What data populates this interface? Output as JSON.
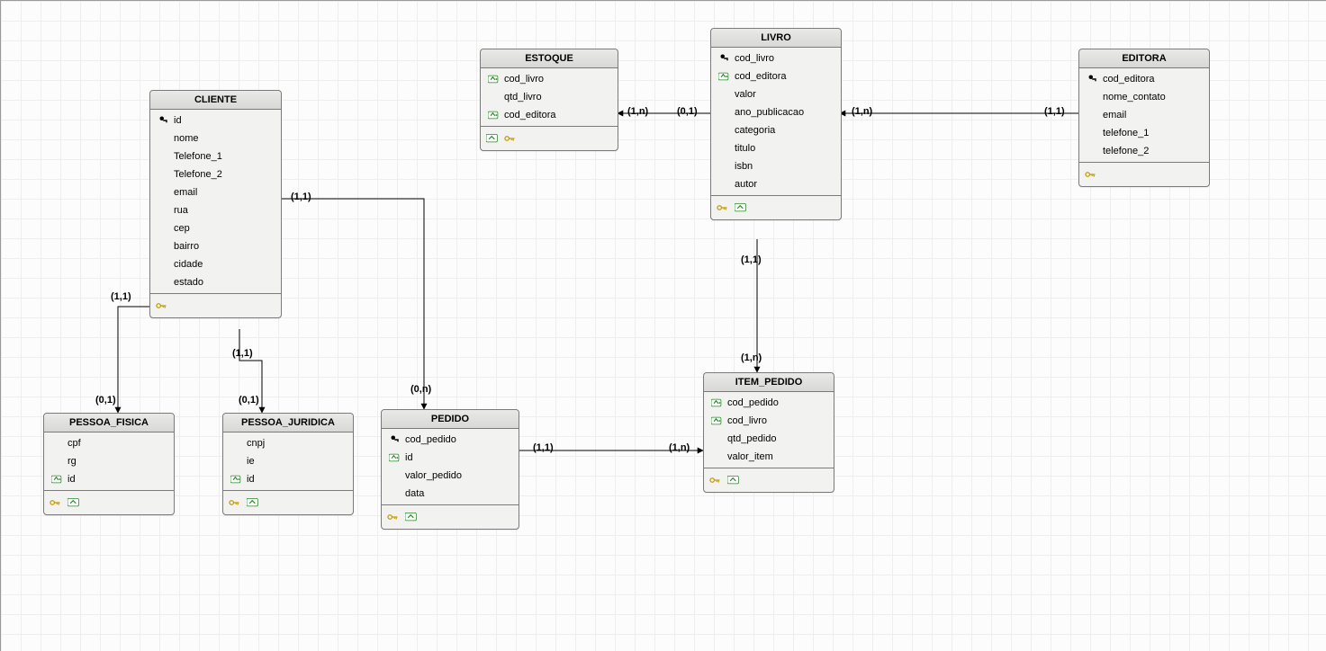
{
  "entities": {
    "cliente": {
      "title": "CLIENTE",
      "attrs": [
        {
          "icon": "pk",
          "label": "id"
        },
        {
          "icon": "none",
          "label": "nome"
        },
        {
          "icon": "none",
          "label": "Telefone_1"
        },
        {
          "icon": "none",
          "label": "Telefone_2"
        },
        {
          "icon": "none",
          "label": "email"
        },
        {
          "icon": "none",
          "label": "rua"
        },
        {
          "icon": "none",
          "label": "cep"
        },
        {
          "icon": "none",
          "label": "bairro"
        },
        {
          "icon": "none",
          "label": "cidade"
        },
        {
          "icon": "none",
          "label": "estado"
        }
      ],
      "footerIcons": [
        "key"
      ]
    },
    "estoque": {
      "title": "ESTOQUE",
      "attrs": [
        {
          "icon": "fk",
          "label": "cod_livro"
        },
        {
          "icon": "none",
          "label": "qtd_livro"
        },
        {
          "icon": "fk",
          "label": "cod_editora"
        }
      ],
      "footerIcons": [
        "tbl",
        "key"
      ]
    },
    "livro": {
      "title": "LIVRO",
      "attrs": [
        {
          "icon": "pk",
          "label": "cod_livro"
        },
        {
          "icon": "fk",
          "label": "cod_editora"
        },
        {
          "icon": "none",
          "label": "valor"
        },
        {
          "icon": "none",
          "label": "ano_publicacao"
        },
        {
          "icon": "none",
          "label": "categoria"
        },
        {
          "icon": "none",
          "label": "titulo"
        },
        {
          "icon": "none",
          "label": "isbn"
        },
        {
          "icon": "none",
          "label": "autor"
        }
      ],
      "footerIcons": [
        "key",
        "tbl"
      ]
    },
    "editora": {
      "title": "EDITORA",
      "attrs": [
        {
          "icon": "pk",
          "label": "cod_editora"
        },
        {
          "icon": "none",
          "label": "nome_contato"
        },
        {
          "icon": "none",
          "label": "email"
        },
        {
          "icon": "none",
          "label": "telefone_1"
        },
        {
          "icon": "none",
          "label": "telefone_2"
        }
      ],
      "footerIcons": [
        "key"
      ]
    },
    "pessoa_fisica": {
      "title": "PESSOA_FISICA",
      "attrs": [
        {
          "icon": "none",
          "label": "cpf"
        },
        {
          "icon": "none",
          "label": "rg"
        },
        {
          "icon": "fk",
          "label": "id"
        }
      ],
      "footerIcons": [
        "key",
        "tbl"
      ]
    },
    "pessoa_juridica": {
      "title": "PESSOA_JURIDICA",
      "attrs": [
        {
          "icon": "none",
          "label": "cnpj"
        },
        {
          "icon": "none",
          "label": "ie"
        },
        {
          "icon": "fk",
          "label": "id"
        }
      ],
      "footerIcons": [
        "key",
        "tbl"
      ]
    },
    "pedido": {
      "title": "PEDIDO",
      "attrs": [
        {
          "icon": "pk",
          "label": "cod_pedido"
        },
        {
          "icon": "fk",
          "label": "id"
        },
        {
          "icon": "none",
          "label": "valor_pedido"
        },
        {
          "icon": "none",
          "label": "data"
        }
      ],
      "footerIcons": [
        "key",
        "tbl"
      ]
    },
    "item_pedido": {
      "title": "ITEM_PEDIDO",
      "attrs": [
        {
          "icon": "fk",
          "label": "cod_pedido"
        },
        {
          "icon": "fk",
          "label": "cod_livro"
        },
        {
          "icon": "none",
          "label": "qtd_pedido"
        },
        {
          "icon": "none",
          "label": "valor_item"
        }
      ],
      "footerIcons": [
        "key",
        "tbl"
      ]
    }
  },
  "labels": {
    "cli_pf_top": "(1,1)",
    "cli_pf_bot": "(0,1)",
    "cli_pj_top": "(1,1)",
    "cli_pj_bot": "(0,1)",
    "cli_ped_top": "(1,1)",
    "cli_ped_bot": "(0,n)",
    "ped_item_left": "(1,1)",
    "ped_item_right": "(1,n)",
    "livro_est_left": "(1,n)",
    "livro_est_right": "(0,1)",
    "livro_edit_left": "(1,n)",
    "livro_edit_right": "(1,1)",
    "livro_item_top": "(1,1)",
    "livro_item_bot": "(1,n)"
  }
}
